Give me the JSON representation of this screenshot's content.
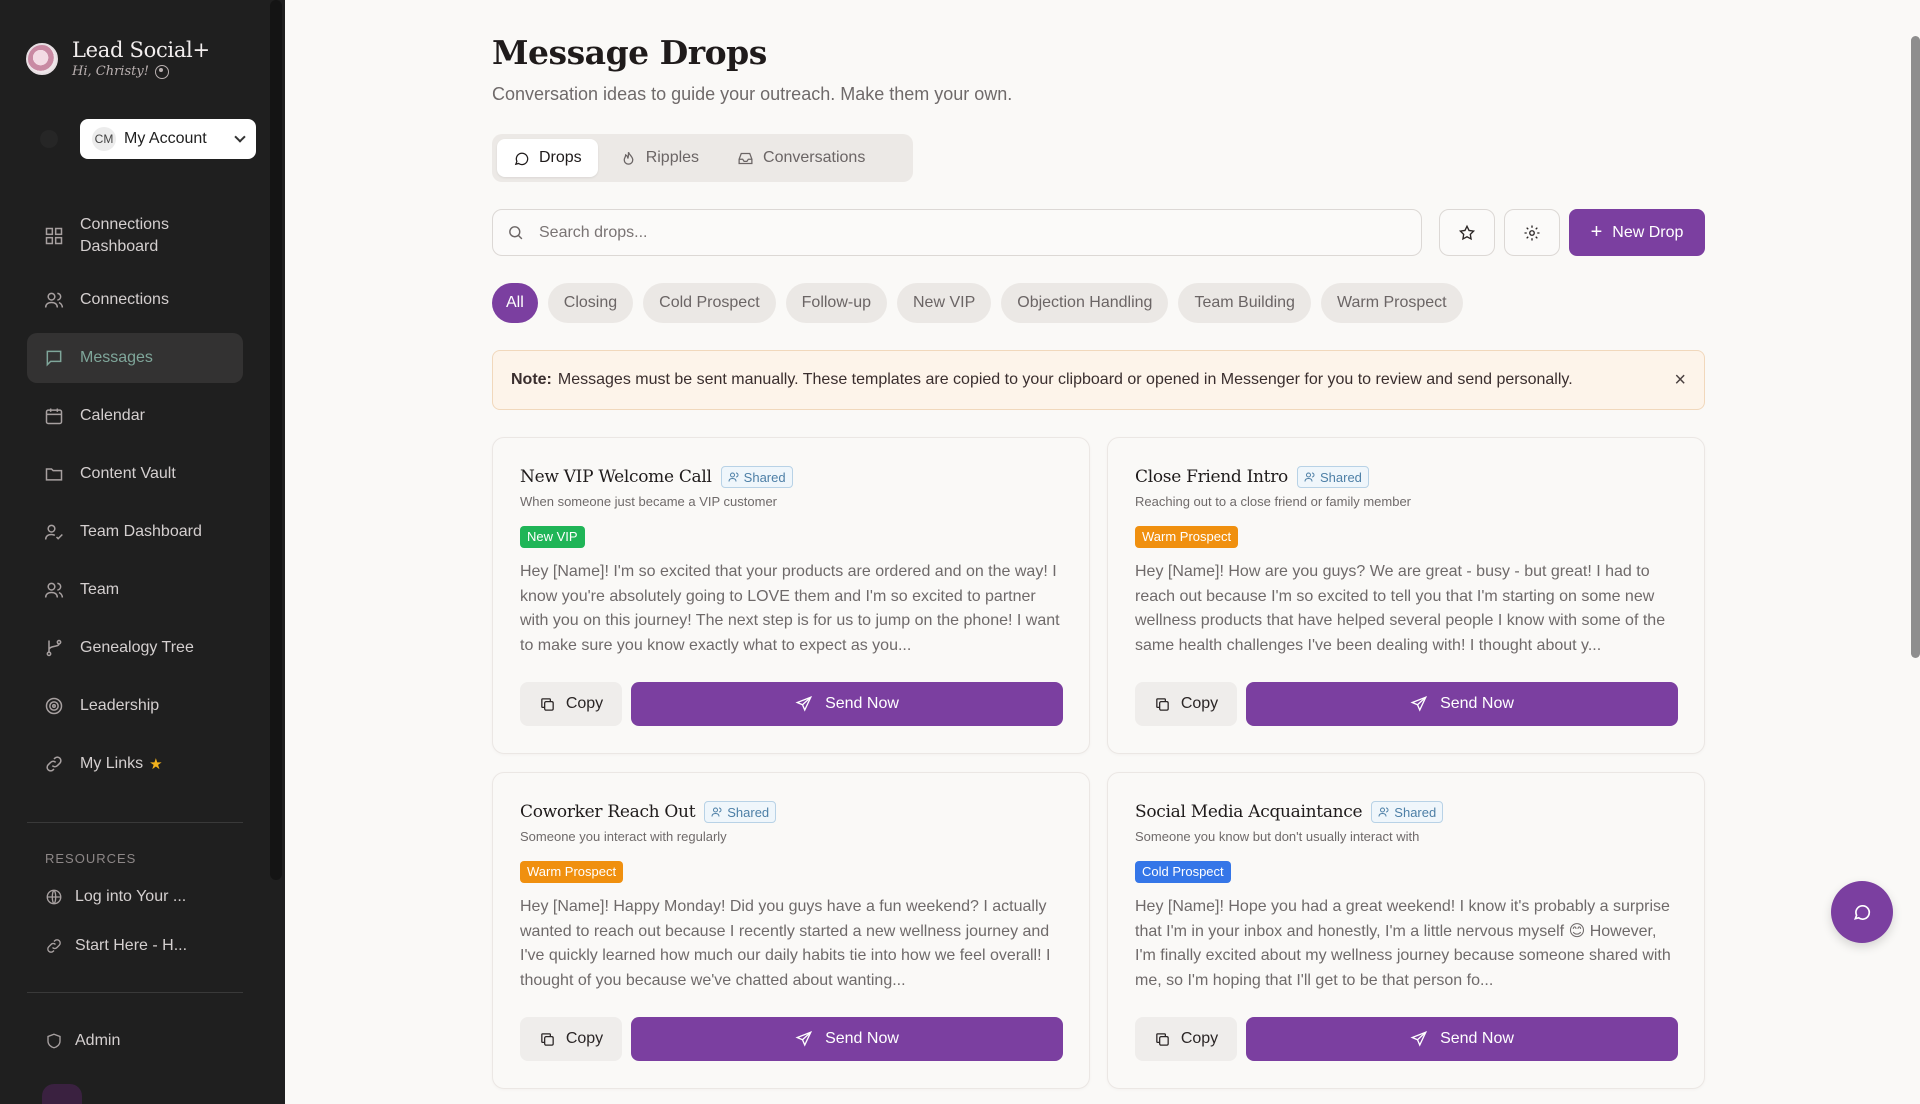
{
  "brand": {
    "title": "Lead Social+",
    "greeting": "Hi, Christy!"
  },
  "account": {
    "initials": "CM",
    "label": "My Account"
  },
  "nav": [
    {
      "label": "Connections Dashboard",
      "icon": "dashboard-icon"
    },
    {
      "label": "Connections",
      "icon": "users-icon"
    },
    {
      "label": "Messages",
      "icon": "message-icon",
      "active": true
    },
    {
      "label": "Calendar",
      "icon": "calendar-icon"
    },
    {
      "label": "Content Vault",
      "icon": "folder-icon"
    },
    {
      "label": "Team Dashboard",
      "icon": "user-check-icon"
    },
    {
      "label": "Team",
      "icon": "users-icon"
    },
    {
      "label": "Genealogy Tree",
      "icon": "branch-icon"
    },
    {
      "label": "Leadership",
      "icon": "target-icon"
    },
    {
      "label": "My Links",
      "icon": "link-icon",
      "badge": "star-icon"
    }
  ],
  "resources": {
    "heading": "RESOURCES",
    "items": [
      {
        "label": "Log into Your ...",
        "icon": "globe-icon"
      },
      {
        "label": "Start Here - H...",
        "icon": "link-icon"
      }
    ]
  },
  "admin": {
    "label": "Admin"
  },
  "page": {
    "title": "Message Drops",
    "subtitle": "Conversation ideas to guide your outreach. Make them your own."
  },
  "tabs": [
    {
      "label": "Drops",
      "active": true
    },
    {
      "label": "Ripples"
    },
    {
      "label": "Conversations"
    }
  ],
  "search": {
    "placeholder": "Search drops...",
    "value": ""
  },
  "new_drop": {
    "label": "New Drop"
  },
  "filters": [
    "All",
    "Closing",
    "Cold Prospect",
    "Follow-up",
    "New VIP",
    "Objection Handling",
    "Team Building",
    "Warm Prospect"
  ],
  "note": {
    "label": "Note:",
    "text": "Messages must be sent manually. These templates are copied to your clipboard or opened in Messenger for you to review and send personally.",
    "close": "×"
  },
  "card_labels": {
    "shared": "Shared",
    "copy": "Copy",
    "send": "Send Now"
  },
  "cards": [
    {
      "title": "New VIP Welcome Call",
      "subtitle": "When someone just became a VIP customer",
      "tag": "New VIP",
      "body": "Hey [Name]! I'm so excited that your products are ordered and on the way! I know you're absolutely going to LOVE them and I'm so excited to partner with you on this journey! The next step is for us to jump on the phone! I want to make sure you know exactly what to expect as you..."
    },
    {
      "title": "Close Friend Intro",
      "subtitle": "Reaching out to a close friend or family member",
      "tag": "Warm Prospect",
      "body": "Hey [Name]! How are you guys? We are great - busy - but great! I had to reach out because I'm so excited to tell you that I'm starting on some new wellness products that have helped several people I know with some of the same health challenges I've been dealing with! I thought about y..."
    },
    {
      "title": "Coworker Reach Out",
      "subtitle": "Someone you interact with regularly",
      "tag": "Warm Prospect",
      "body": "Hey [Name]! Happy Monday! Did you guys have a fun weekend? I actually wanted to reach out because I recently started a new wellness journey and I've quickly learned how much our daily habits tie into how we feel overall! I thought of you because we've chatted about wanting..."
    },
    {
      "title": "Social Media Acquaintance",
      "subtitle": "Someone you know but don't usually interact with",
      "tag": "Cold Prospect",
      "body": "Hey [Name]! Hope you had a great weekend! I know it's probably a surprise that I'm in your inbox and honestly, I'm a little nervous myself 😊 However, I'm finally excited about my wellness journey because someone shared with me, so I'm hoping that I'll get to be that person fo..."
    }
  ],
  "colors": {
    "accent": "#7b3fa0",
    "sidebar": "#1f1f1f",
    "active_nav": "#7fa69a",
    "vip": "#1fb557",
    "warm": "#f0900f",
    "cold": "#3576e8"
  }
}
